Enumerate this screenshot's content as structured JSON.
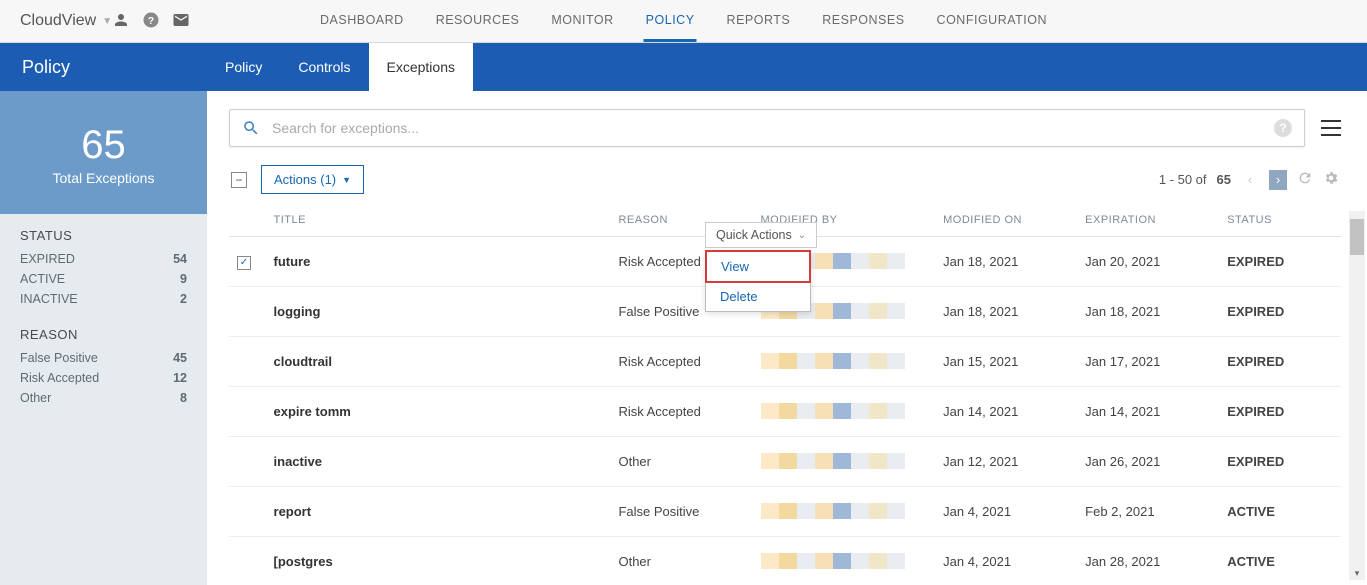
{
  "brand": "CloudView",
  "topnav": [
    "DASHBOARD",
    "RESOURCES",
    "MONITOR",
    "POLICY",
    "REPORTS",
    "RESPONSES",
    "CONFIGURATION"
  ],
  "topnav_active": 3,
  "section_title": "Policy",
  "section_tabs": [
    "Policy",
    "Controls",
    "Exceptions"
  ],
  "section_active": 2,
  "sidebar": {
    "stat_number": "65",
    "stat_label": "Total Exceptions",
    "facets": [
      {
        "title": "STATUS",
        "rows": [
          {
            "label": "EXPIRED",
            "count": "54"
          },
          {
            "label": "ACTIVE",
            "count": "9"
          },
          {
            "label": "INACTIVE",
            "count": "2"
          }
        ]
      },
      {
        "title": "REASON",
        "rows": [
          {
            "label": "False Positive",
            "count": "45"
          },
          {
            "label": "Risk Accepted",
            "count": "12"
          },
          {
            "label": "Other",
            "count": "8"
          }
        ]
      }
    ]
  },
  "search": {
    "placeholder": "Search for exceptions..."
  },
  "actions_label": "Actions (1)",
  "pager": {
    "range": "1 - 50 of",
    "total": "65"
  },
  "columns": [
    "TITLE",
    "REASON",
    "MODIFIED BY",
    "MODIFIED ON",
    "EXPIRATION",
    "STATUS"
  ],
  "rows": [
    {
      "checked": true,
      "title": "future",
      "reason": "Risk Accepted",
      "modified_on": "Jan 18, 2021",
      "expiration": "Jan 20, 2021",
      "status": "EXPIRED"
    },
    {
      "checked": false,
      "title": "logging",
      "reason": "False Positive",
      "modified_on": "Jan 18, 2021",
      "expiration": "Jan 18, 2021",
      "status": "EXPIRED"
    },
    {
      "checked": false,
      "title": "cloudtrail",
      "reason": "Risk Accepted",
      "modified_on": "Jan 15, 2021",
      "expiration": "Jan 17, 2021",
      "status": "EXPIRED"
    },
    {
      "checked": false,
      "title": "expire tomm",
      "reason": "Risk Accepted",
      "modified_on": "Jan 14, 2021",
      "expiration": "Jan 14, 2021",
      "status": "EXPIRED"
    },
    {
      "checked": false,
      "title": "inactive",
      "reason": "Other",
      "modified_on": "Jan 12, 2021",
      "expiration": "Jan 26, 2021",
      "status": "EXPIRED"
    },
    {
      "checked": false,
      "title": "report",
      "reason": "False Positive",
      "modified_on": "Jan 4, 2021",
      "expiration": "Feb 2, 2021",
      "status": "ACTIVE"
    },
    {
      "checked": false,
      "title": "[postgres",
      "reason": "Other",
      "modified_on": "Jan 4, 2021",
      "expiration": "Jan 28, 2021",
      "status": "ACTIVE"
    }
  ],
  "quick_actions": {
    "label": "Quick Actions",
    "items": [
      "View",
      "Delete"
    ]
  },
  "redacted_colors": [
    "#fde9c7",
    "#f3d9a0",
    "#e9ecf0",
    "#f7e0b5",
    "#9fb8d8",
    "#e9ecf0",
    "#f2e6c9",
    "#e9ecf0"
  ]
}
